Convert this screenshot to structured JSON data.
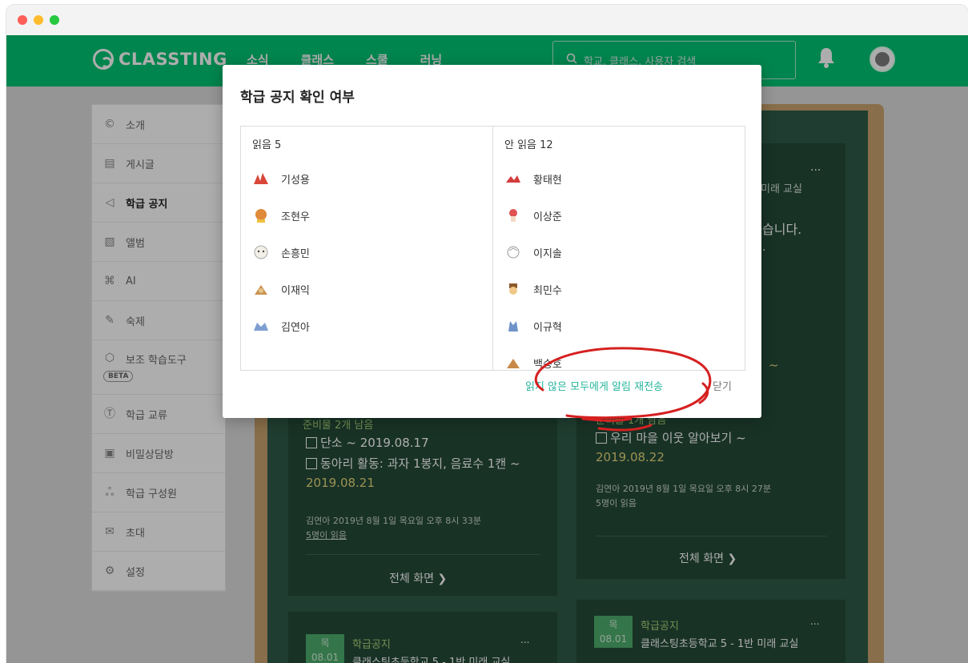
{
  "app": {
    "brand": "CLASSTING",
    "nav": [
      "소식",
      "클래스",
      "스쿨",
      "러닝"
    ],
    "search_placeholder": "학교, 클래스, 사용자 검색"
  },
  "sidebar": {
    "items": [
      {
        "label": "소개",
        "icon": "copyright-icon"
      },
      {
        "label": "게시글",
        "icon": "post-icon"
      },
      {
        "label": "학급 공지",
        "icon": "megaphone-icon",
        "active": true
      },
      {
        "label": "앨범",
        "icon": "image-icon"
      },
      {
        "label": "AI",
        "icon": "chip-icon"
      },
      {
        "label": "숙제",
        "icon": "pencil-icon"
      },
      {
        "label": "보조 학습도구",
        "icon": "cube-icon",
        "badge": "BETA"
      },
      {
        "label": "학급 교류",
        "icon": "t-box-icon"
      },
      {
        "label": "비밀상담방",
        "icon": "lock-box-icon"
      },
      {
        "label": "학급 구성원",
        "icon": "people-icon"
      },
      {
        "label": "초대",
        "icon": "invite-icon"
      },
      {
        "label": "설정",
        "icon": "gear-icon"
      }
    ]
  },
  "board": {
    "card1": {
      "supplies": "준비물 2개 남음",
      "item1_name": "단소",
      "item1_date": "~ 2019.08.17",
      "item2_name": "동아리 활동: 과자 1봉지, 음료수 1캔",
      "item2_date": "~",
      "item2_date2": "2019.08.21",
      "meta": "김연아 2019년 8월 1일 목요일 오후 8시 33분",
      "read": "5명이 읽음",
      "full": "전체 화면"
    },
    "card2": {
      "more": "...",
      "class": "미래 교실",
      "snippet1": "습니다.",
      "snippet2": ".",
      "tilde": "~",
      "supplies": "준비물 1개 남음",
      "item1_name": "우리 마을 이웃 알아보기",
      "item1_date": "~",
      "item1_date2": "2019.08.22",
      "meta": "김연아 2019년 8월 1일 목요일 오후 8시 27분",
      "read": "5명이 읽음",
      "full": "전체 화면"
    },
    "card3": {
      "day": "목",
      "date": "08.01",
      "type": "학급공지",
      "class": "클래스팅초등학교 5 - 1반 미래 교실",
      "more": "..."
    },
    "card4": {
      "day": "목",
      "date": "08.01",
      "type": "학급공지",
      "class": "클래스팅초등학교 5 - 1반 미래 교실",
      "more": "..."
    }
  },
  "modal": {
    "title": "학급 공지 확인 여부",
    "read_header": "읽음 5",
    "unread_header": "안 읽음 12",
    "read_users": [
      "기성용",
      "조현우",
      "손흥민",
      "이재익",
      "김연아"
    ],
    "unread_users": [
      "황태현",
      "이상준",
      "이지솔",
      "최민수",
      "이규혁",
      "백승호"
    ],
    "resend_label": "읽지 않은 모두에게 알림 재전송",
    "close_label": "닫기"
  },
  "colors": {
    "brand": "#00c473",
    "resend": "#25b59b",
    "board": "#2f5a47",
    "annotation": "#d62020"
  }
}
